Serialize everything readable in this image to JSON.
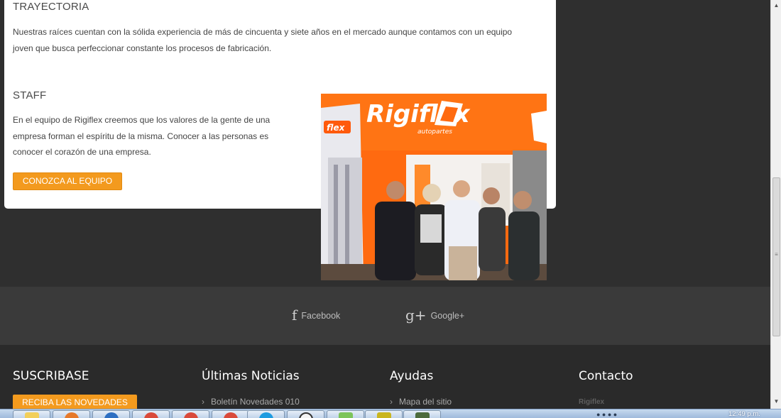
{
  "trayectoria": {
    "title": "TRAYECTORIA",
    "line1": "Nuestras raíces cuentan con la sólida experiencia de más de cincuenta y siete años en el mercado aunque contamos con un equipo",
    "line2": "joven que busca perfeccionar constante los procesos de fabricación."
  },
  "staff": {
    "title": "STAFF",
    "line1": "En el equipo de Rigiflex creemos que los valores de la gente de una",
    "line2": "empresa forman el espíritu de la misma. Conocer a las personas es",
    "line3": "conocer el corazón de una empresa.",
    "button": "CONOZCA AL EQUIPO",
    "photo": {
      "brand": "Rigiflex",
      "sub": "autopartes",
      "side_brand": "flex"
    }
  },
  "social": {
    "facebook_icon": "f",
    "facebook": "Facebook",
    "google_icon": "g+",
    "google": "Google+"
  },
  "footer": {
    "subscribe": {
      "title": "SUSCRIBASE",
      "button": "RECIBA LAS NOVEDADES"
    },
    "news": {
      "title": "Últimas Noticias",
      "item": "Boletín Novedades 010"
    },
    "help": {
      "title": "Ayudas",
      "item": "Mapa del sitio"
    },
    "contact": {
      "title": "Contacto",
      "name": "Rigiflex"
    }
  },
  "taskbar": {
    "clock": "12:49 p.m.",
    "apps": [
      "explorer",
      "firefox",
      "media",
      "chrome",
      "chrome-2",
      "chrome-3",
      "skype",
      "picasa",
      "maps",
      "notes",
      "evernote"
    ]
  },
  "colors": {
    "accent": "#f39a1e",
    "dark": "#2f2f2f",
    "brand_orange": "#ff6a10"
  }
}
